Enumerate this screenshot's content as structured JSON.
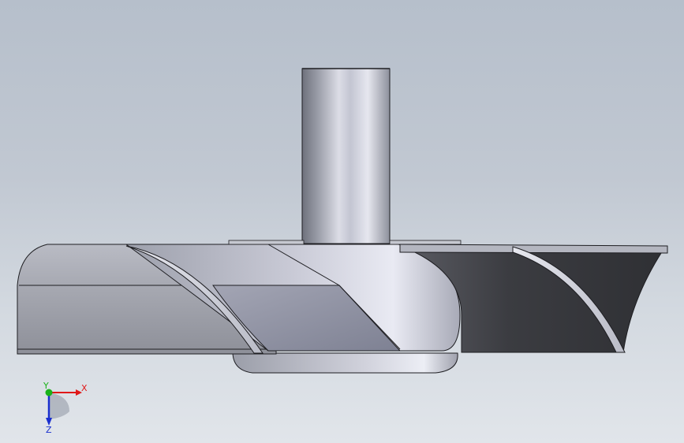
{
  "viewport": {
    "background_top": "#b6bfcb",
    "background_bottom": "#e1e5ea"
  },
  "model": {
    "body_color": "#9fa2ad",
    "shadow_color": "#3f4046",
    "edge_color": "#1e1e22"
  },
  "triad": {
    "x_label": "X",
    "y_label": "Y",
    "z_label": "Z",
    "x_color": "#e01818",
    "y_color": "#19b219",
    "z_color": "#1a2fcf"
  }
}
